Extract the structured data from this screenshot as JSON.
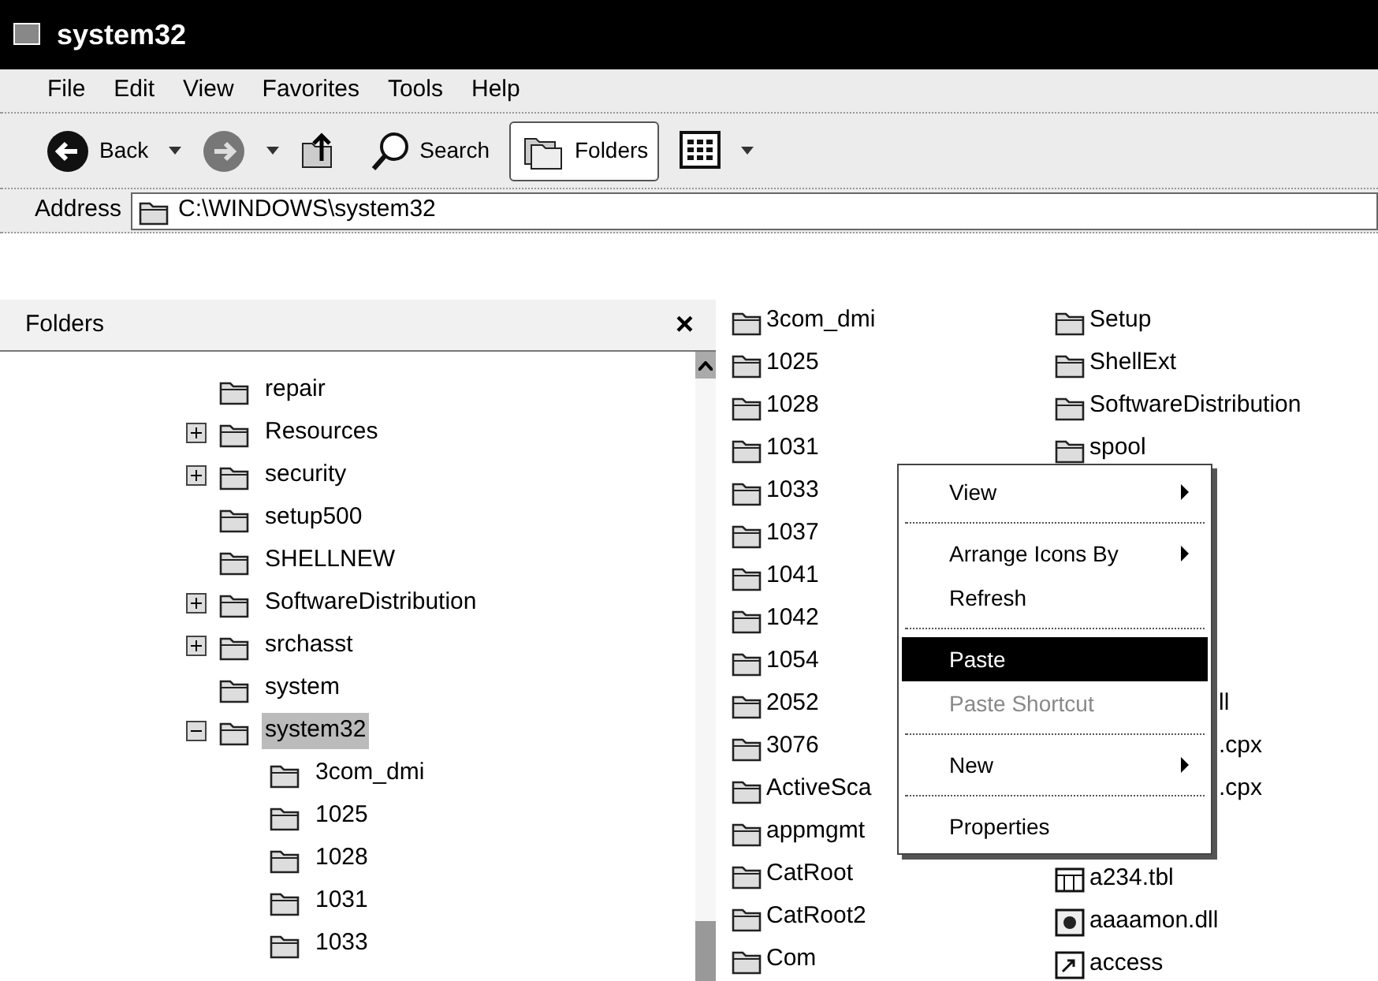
{
  "window": {
    "title": "system32"
  },
  "menu_bar": [
    "File",
    "Edit",
    "View",
    "Favorites",
    "Tools",
    "Help"
  ],
  "toolbar": [
    {
      "kind": "back",
      "label": "Back",
      "dropdown": true,
      "pressed": false
    },
    {
      "kind": "forward",
      "dropdown": true,
      "pressed": false
    },
    {
      "kind": "up",
      "pressed": false
    },
    {
      "kind": "search",
      "label": "Search",
      "pressed": false
    },
    {
      "kind": "folders",
      "label": "Folders",
      "pressed": true
    },
    {
      "kind": "views",
      "dropdown": true,
      "pressed": false
    }
  ],
  "address_bar": {
    "label": "Address",
    "value": "C:\\WINDOWS\\system32"
  },
  "folders_pane": {
    "title": "Folders",
    "close": "×",
    "tree": [
      {
        "label": "repair",
        "selected": false
      },
      {
        "label": "Resources",
        "expanded": false,
        "selected": false
      },
      {
        "label": "security",
        "expanded": false,
        "selected": false
      },
      {
        "label": "setup500",
        "selected": false
      },
      {
        "label": "SHELLNEW",
        "selected": false
      },
      {
        "label": "SoftwareDistribution",
        "expanded": false,
        "selected": false
      },
      {
        "label": "srchasst",
        "expanded": false,
        "selected": false
      },
      {
        "label": "system",
        "selected": false
      },
      {
        "label": "system32",
        "expanded": true,
        "selected": true,
        "children": [
          {
            "label": "3com_dmi",
            "selected": false
          },
          {
            "label": "1025",
            "selected": false
          },
          {
            "label": "1028",
            "selected": false
          },
          {
            "label": "1031",
            "selected": false
          },
          {
            "label": "1033",
            "selected": false
          }
        ]
      }
    ]
  },
  "file_list": {
    "column_1": [
      {
        "label": "3com_dmi",
        "kind": "folder"
      },
      {
        "label": "1025",
        "kind": "folder"
      },
      {
        "label": "1028",
        "kind": "folder"
      },
      {
        "label": "1031",
        "kind": "folder"
      },
      {
        "label": "1033",
        "kind": "folder"
      },
      {
        "label": "1037",
        "kind": "folder"
      },
      {
        "label": "1041",
        "kind": "folder"
      },
      {
        "label": "1042",
        "kind": "folder"
      },
      {
        "label": "1054",
        "kind": "folder"
      },
      {
        "label": "2052",
        "kind": "folder"
      },
      {
        "label": "3076",
        "kind": "folder"
      },
      {
        "label": "ActiveSca",
        "kind": "folder"
      },
      {
        "label": "appmgmt",
        "kind": "folder"
      },
      {
        "label": "CatRoot",
        "kind": "folder"
      },
      {
        "label": "CatRoot2",
        "kind": "folder"
      },
      {
        "label": "Com",
        "kind": "folder"
      }
    ],
    "column_2_top": [
      {
        "label": "Setup",
        "kind": "folder"
      },
      {
        "label": "ShellExt",
        "kind": "folder"
      },
      {
        "label": "SoftwareDistribution",
        "kind": "folder"
      },
      {
        "label": "spool",
        "kind": "folder"
      }
    ],
    "column_2_middle": [
      {
        "label": "ll",
        "kind": "fragment"
      },
      {
        "label": ".cpx",
        "kind": "fragment"
      },
      {
        "label": ".cpx",
        "kind": "fragment"
      }
    ],
    "column_2_bottom": [
      {
        "label": "a234.tbl",
        "kind": "table-file"
      },
      {
        "label": "aaaamon.dll",
        "kind": "dll-file"
      },
      {
        "label": "access",
        "kind": "shortcut-file"
      }
    ]
  },
  "context_menu": [
    {
      "label": "View",
      "submenu": true,
      "selected": false,
      "disabled": false
    },
    {
      "kind": "separator"
    },
    {
      "label": "Arrange Icons By",
      "submenu": true,
      "selected": false,
      "disabled": false
    },
    {
      "label": "Refresh",
      "submenu": false,
      "selected": false,
      "disabled": false
    },
    {
      "kind": "separator"
    },
    {
      "label": "Paste",
      "submenu": false,
      "selected": true,
      "disabled": false
    },
    {
      "label": "Paste Shortcut",
      "submenu": false,
      "selected": false,
      "disabled": true
    },
    {
      "kind": "separator"
    },
    {
      "label": "New",
      "submenu": true,
      "selected": false,
      "disabled": false
    },
    {
      "kind": "separator"
    },
    {
      "label": "Properties",
      "submenu": false,
      "selected": false,
      "disabled": false
    }
  ]
}
